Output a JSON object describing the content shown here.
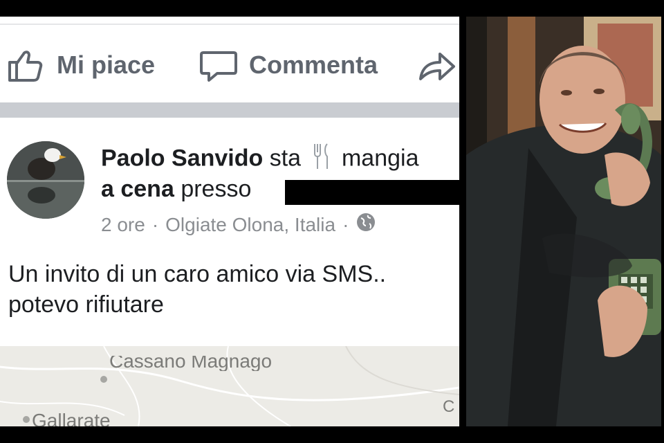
{
  "actions": {
    "like_label": "Mi piace",
    "comment_label": "Commenta"
  },
  "post": {
    "author": "Paolo Sanvido",
    "status_prefix": "sta",
    "activity": "mangia",
    "activity_target": "a cena",
    "location_prefix": "presso",
    "time": "2 ore",
    "location": "Olgiate Olona, Italia",
    "text_line1": "Un invito di un caro amico via SMS..",
    "text_line2": "potevo rifiutare"
  },
  "map": {
    "labels": [
      "Cassano Magnago",
      "Gallarate",
      "C"
    ]
  },
  "icons": [
    "thumbs-up-icon",
    "comment-bubble-icon",
    "share-arrow-icon",
    "fork-knife-icon",
    "globe-icon"
  ],
  "colors": {
    "text": "#1c1e21",
    "muted": "#5f656e",
    "meta": "#8a8d91",
    "separator": "#c9ccd1",
    "map_bg": "#ecebe6"
  }
}
